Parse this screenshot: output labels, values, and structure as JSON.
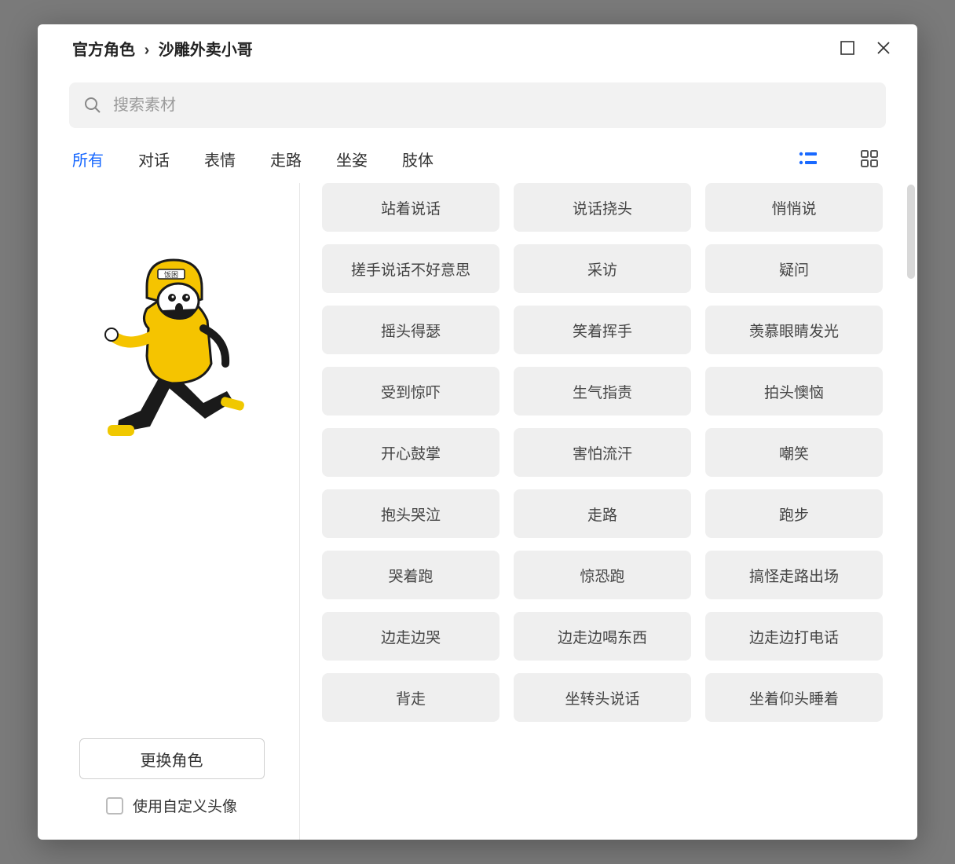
{
  "breadcrumb": {
    "root": "官方角色",
    "sep": "›",
    "current": "沙雕外卖小哥"
  },
  "search": {
    "placeholder": "搜索素材"
  },
  "tabs": [
    "所有",
    "对话",
    "表情",
    "走路",
    "坐姿",
    "肢体"
  ],
  "activeTab": 0,
  "char_label": "饭困",
  "change_btn": "更换角色",
  "custom_avatar_label": "使用自定义头像",
  "items": [
    "站着说话",
    "说话挠头",
    "悄悄说",
    "搓手说话不好意思",
    "采访",
    "疑问",
    "摇头得瑟",
    "笑着挥手",
    "羡慕眼睛发光",
    "受到惊吓",
    "生气指责",
    "拍头懊恼",
    "开心鼓掌",
    "害怕流汗",
    "嘲笑",
    "抱头哭泣",
    "走路",
    "跑步",
    "哭着跑",
    "惊恐跑",
    "搞怪走路出场",
    "边走边哭",
    "边走边喝东西",
    "边走边打电话",
    "背走",
    "坐转头说话",
    "坐着仰头睡着"
  ]
}
